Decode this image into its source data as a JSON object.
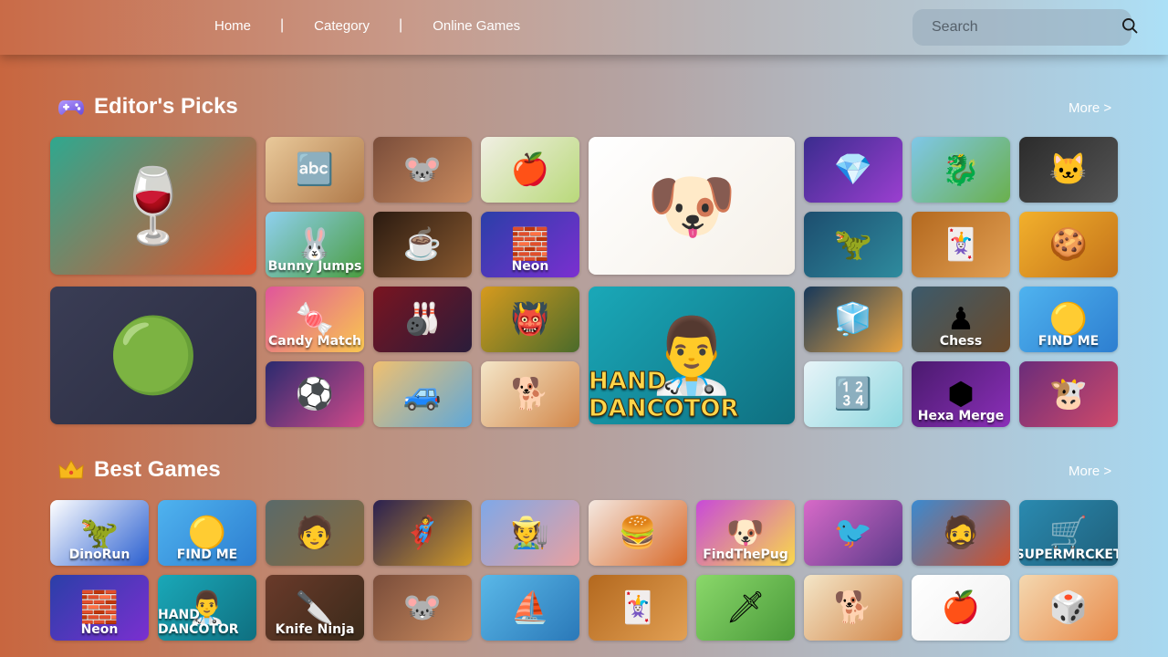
{
  "nav": {
    "items": [
      "Home",
      "Category",
      "Online Games"
    ],
    "separator": "|"
  },
  "search": {
    "placeholder": "Search",
    "icon": "search-icon"
  },
  "sections": {
    "editors_picks": {
      "title": "Editor's Picks",
      "icon": "gamepad-icon",
      "more": "More >"
    },
    "best_games": {
      "title": "Best Games",
      "icon": "crown-icon",
      "more": "More >"
    }
  },
  "editors_tiles": [
    {
      "name": "carnival-chef-game",
      "glyph": "🍷",
      "caption": "",
      "colors": [
        "#2fa88f",
        "#e2512a"
      ]
    },
    {
      "name": "word-search-game",
      "glyph": "🔤",
      "caption": "",
      "colors": [
        "#e9c99a",
        "#b07a4a"
      ]
    },
    {
      "name": "mouse-star-game",
      "glyph": "🐭",
      "caption": "",
      "colors": [
        "#7a4d3a",
        "#c98a5e"
      ]
    },
    {
      "name": "apple-shot-game",
      "glyph": "🍎",
      "caption": "",
      "colors": [
        "#f1efe4",
        "#b9d97a"
      ]
    },
    {
      "name": "dog-game",
      "glyph": "🐶",
      "caption": "",
      "colors": [
        "#ffffff",
        "#f5f0e8"
      ]
    },
    {
      "name": "gems-game",
      "glyph": "💎",
      "caption": "",
      "colors": [
        "#3a2c8e",
        "#9b3fd0"
      ]
    },
    {
      "name": "dragon-game",
      "glyph": "🐉",
      "caption": "",
      "colors": [
        "#7fc7e8",
        "#6ab04c"
      ]
    },
    {
      "name": "pets-puzzle-game",
      "glyph": "🐱",
      "caption": "",
      "colors": [
        "#2b2b2b",
        "#555555"
      ]
    },
    {
      "name": "bunny-jumps-game",
      "glyph": "🐰",
      "caption": "Bunny Jumps",
      "colors": [
        "#8fd0ef",
        "#4a9d3f"
      ]
    },
    {
      "name": "water-cup-game",
      "glyph": "☕",
      "caption": "",
      "colors": [
        "#2a1a10",
        "#8a5a30"
      ]
    },
    {
      "name": "neon-blocks-game",
      "glyph": "🧱",
      "caption": "Neon",
      "colors": [
        "#2a3fa8",
        "#7b2fd0"
      ]
    },
    {
      "name": "dino-runner-game",
      "glyph": "🦖",
      "caption": "",
      "colors": [
        "#1c4d6e",
        "#2e8b9e"
      ]
    },
    {
      "name": "solitaire-game",
      "glyph": "🃏",
      "caption": "",
      "colors": [
        "#b3681e",
        "#e2a054"
      ]
    },
    {
      "name": "cookie-clicker-game",
      "glyph": "🍪",
      "caption": "",
      "colors": [
        "#f2b02c",
        "#c4731a"
      ]
    },
    {
      "name": "color-balls-game",
      "glyph": "🟢",
      "caption": "",
      "colors": [
        "#3a3d55",
        "#2a2c40"
      ]
    },
    {
      "name": "candy-match-game",
      "glyph": "🍬",
      "caption": "Candy Match",
      "colors": [
        "#e0559b",
        "#f9c74f"
      ]
    },
    {
      "name": "bowling-game",
      "glyph": "🎳",
      "caption": "",
      "colors": [
        "#7a1420",
        "#2a1c3a"
      ]
    },
    {
      "name": "ogre-warrior-game",
      "glyph": "👹",
      "caption": "",
      "colors": [
        "#d69a1e",
        "#4a6b2a"
      ]
    },
    {
      "name": "hand-doctor-game",
      "glyph": "👨‍⚕️",
      "caption": "HAND DANCOTOR",
      "colors": [
        "#1aa8b8",
        "#0f6f80"
      ]
    },
    {
      "name": "cube-runner-game",
      "glyph": "🧊",
      "caption": "",
      "colors": [
        "#17385a",
        "#e8a340"
      ]
    },
    {
      "name": "chess-game",
      "glyph": "♟",
      "caption": "Chess",
      "colors": [
        "#3c5a6b",
        "#6b4a2a"
      ]
    },
    {
      "name": "find-me-game",
      "glyph": "🟡",
      "caption": "FIND ME",
      "colors": [
        "#4fb3ef",
        "#2d7ed0"
      ]
    },
    {
      "name": "soccer-game",
      "glyph": "⚽",
      "caption": "",
      "colors": [
        "#2a2a6e",
        "#d04a8a"
      ]
    },
    {
      "name": "car-city-game",
      "glyph": "🚙",
      "caption": "",
      "colors": [
        "#f0c070",
        "#5fa8d8"
      ]
    },
    {
      "name": "pet-shop-game",
      "glyph": "🐕",
      "caption": "",
      "colors": [
        "#f4e6c8",
        "#d2874a"
      ]
    },
    {
      "name": "cube-merge-game",
      "glyph": "🔢",
      "caption": "",
      "colors": [
        "#e8f4f8",
        "#8ed8e0"
      ]
    },
    {
      "name": "hexa-merge-game",
      "glyph": "⬢",
      "caption": "Hexa Merge",
      "colors": [
        "#4a1a6e",
        "#8b2fb8"
      ]
    },
    {
      "name": "monster-cow-game",
      "glyph": "🐮",
      "caption": "",
      "colors": [
        "#6a2c7a",
        "#d04a6a"
      ]
    }
  ],
  "best_tiles": [
    {
      "name": "dino-run-game",
      "glyph": "🦖",
      "caption": "DinoRun",
      "colors": [
        "#ffffff",
        "#2a5fd0"
      ]
    },
    {
      "name": "find-me-game-2",
      "glyph": "🟡",
      "caption": "FIND ME",
      "colors": [
        "#4fb3ef",
        "#2d7ed0"
      ]
    },
    {
      "name": "survivor-game",
      "glyph": "🧑",
      "caption": "",
      "colors": [
        "#5a6a6a",
        "#8a6a3a"
      ]
    },
    {
      "name": "hero-warrior-game",
      "glyph": "🦸",
      "caption": "",
      "colors": [
        "#2a2050",
        "#d09a2a"
      ]
    },
    {
      "name": "farmer-game",
      "glyph": "🧑‍🌾",
      "caption": "",
      "colors": [
        "#7fa8e8",
        "#e8a0a0"
      ]
    },
    {
      "name": "burger-game",
      "glyph": "🍔",
      "caption": "",
      "colors": [
        "#f4e8e0",
        "#d86a2a"
      ]
    },
    {
      "name": "find-the-pug-game",
      "glyph": "🐶",
      "caption": "FindThePug",
      "colors": [
        "#c84ad8",
        "#f9d94a"
      ]
    },
    {
      "name": "blue-bird-game",
      "glyph": "🐦",
      "caption": "",
      "colors": [
        "#d86ac8",
        "#5a3a8a"
      ]
    },
    {
      "name": "captain-game",
      "glyph": "🧔",
      "caption": "",
      "colors": [
        "#3a8ad0",
        "#d0502a"
      ]
    },
    {
      "name": "tap-supermarket-game",
      "glyph": "🛒",
      "caption": "SUPERMRCKET",
      "colors": [
        "#2a8ab0",
        "#1f5f7a"
      ]
    },
    {
      "name": "neon-blocks-game-2",
      "glyph": "🧱",
      "caption": "Neon",
      "colors": [
        "#2a3fa8",
        "#7b2fd0"
      ]
    },
    {
      "name": "hand-doctor-game-2",
      "glyph": "👨‍⚕️",
      "caption": "HAND DANCOTOR",
      "colors": [
        "#1aa8b8",
        "#0f6f80"
      ]
    },
    {
      "name": "knife-ninja-game",
      "glyph": "🔪",
      "caption": "Knife Ninja",
      "colors": [
        "#6a3a2a",
        "#3a2a1a"
      ]
    },
    {
      "name": "mouse-star-game-2",
      "glyph": "🐭",
      "caption": "",
      "colors": [
        "#7a4d3a",
        "#c98a5e"
      ]
    },
    {
      "name": "boat-game",
      "glyph": "⛵",
      "caption": "",
      "colors": [
        "#5ab8e8",
        "#2a78b8"
      ]
    },
    {
      "name": "solitaire-game-2",
      "glyph": "🃏",
      "caption": "",
      "colors": [
        "#b3681e",
        "#e2a054"
      ]
    },
    {
      "name": "pixel-adventure-game",
      "glyph": "🗡",
      "caption": "",
      "colors": [
        "#8ad86a",
        "#4a9a3a"
      ]
    },
    {
      "name": "pet-shop-game-2",
      "glyph": "🐕",
      "caption": "",
      "colors": [
        "#f4e6c8",
        "#d2874a"
      ]
    },
    {
      "name": "apple-game",
      "glyph": "🍎",
      "caption": "",
      "colors": [
        "#ffffff",
        "#f0f0f0"
      ]
    },
    {
      "name": "dice-game",
      "glyph": "🎲",
      "caption": "",
      "colors": [
        "#f4d8b0",
        "#e88a4a"
      ]
    }
  ]
}
